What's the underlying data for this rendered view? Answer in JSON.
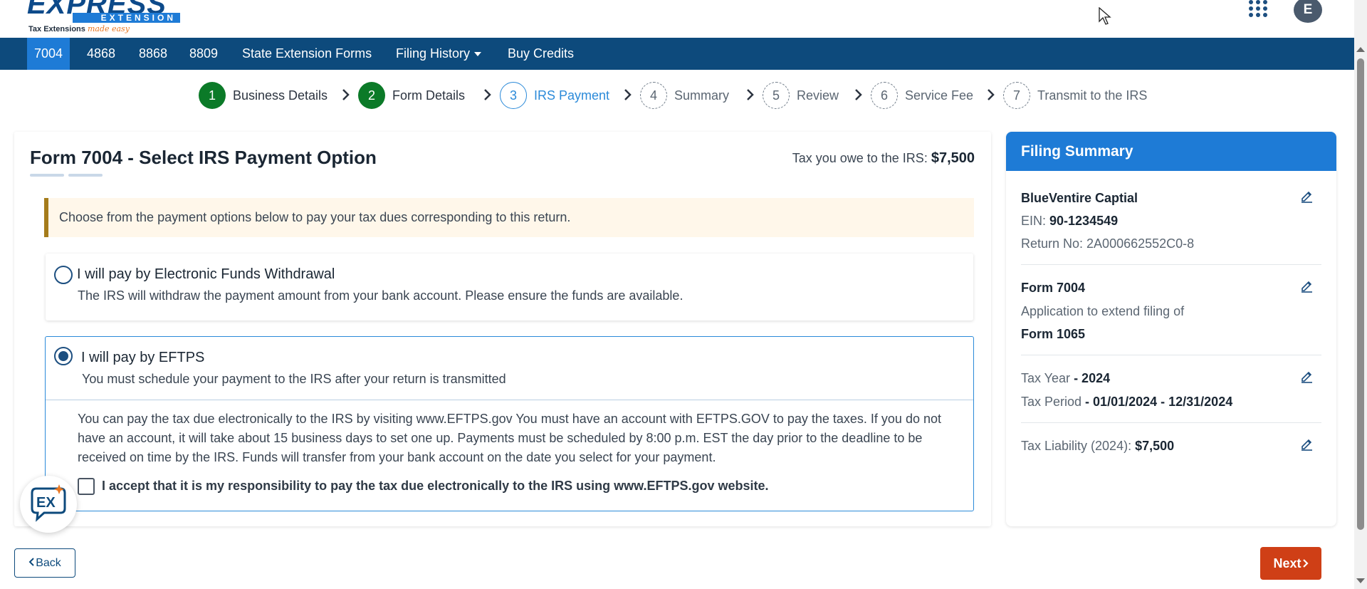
{
  "header": {
    "logo_main": "EXPRESS",
    "logo_band": "EXTENSION",
    "logo_tagline": "Tax Extensions",
    "logo_tagline_script": "made easy",
    "avatar_initial": "E"
  },
  "nav": {
    "items": [
      {
        "label": "7004",
        "active": true
      },
      {
        "label": "4868"
      },
      {
        "label": "8868"
      },
      {
        "label": "8809"
      },
      {
        "label": "State Extension Forms"
      },
      {
        "label": "Filing History",
        "dropdown": true
      },
      {
        "label": "Buy Credits"
      }
    ]
  },
  "stepper": {
    "steps": [
      {
        "number": "1",
        "label": "Business Details",
        "state": "done"
      },
      {
        "number": "2",
        "label": "Form Details",
        "state": "done"
      },
      {
        "number": "3",
        "label": "IRS Payment",
        "state": "current"
      },
      {
        "number": "4",
        "label": "Summary",
        "state": "todo"
      },
      {
        "number": "5",
        "label": "Review",
        "state": "todo"
      },
      {
        "number": "6",
        "label": "Service Fee",
        "state": "todo"
      },
      {
        "number": "7",
        "label": "Transmit to the IRS",
        "state": "todo"
      }
    ]
  },
  "main": {
    "title": "Form 7004 - Select IRS Payment Option",
    "tax_owe_label": "Tax you owe to the IRS: ",
    "tax_owe_value": "$7,500",
    "notice": "Choose from the payment options below to pay your tax dues corresponding to this return.",
    "option_efw": {
      "title": "I will pay by Electronic Funds Withdrawal",
      "description": "The IRS will withdraw the payment amount from your bank account. Please ensure the funds are available.",
      "selected": false
    },
    "option_eftps": {
      "title": "I will pay by EFTPS",
      "description": "You must schedule your payment to the IRS after your return is transmitted",
      "selected": true,
      "details": "You can pay the tax due electronically to the IRS by visiting www.EFTPS.gov You must have an account with EFTPS.GOV to pay the taxes. If you do not have an account, it will take about 15 business days to set one up. Payments must be scheduled by 8:00 p.m. EST the day prior to the deadline to be received on time by the IRS. Funds will transfer from your bank account on the date you select for your payment.",
      "accept_label": "I accept that it is my responsibility to pay the tax due electronically to the IRS using www.EFTPS.gov website.",
      "accept_checked": false
    }
  },
  "summary": {
    "heading": "Filing Summary",
    "business_name": "BlueVentire Captial",
    "ein_label": "EIN: ",
    "ein_value": "90-1234549",
    "return_no": "Return No: 2A000662552C0-8",
    "form_name": "Form 7004",
    "form_desc": "Application to extend filing of",
    "form_target": "Form 1065",
    "tax_year_label": "Tax Year ",
    "tax_year_value": "- 2024",
    "tax_period_label": "Tax Period ",
    "tax_period_value": "- 01/01/2024 - 12/31/2024",
    "liability_label": "Tax Liability (2024): ",
    "liability_value": "$7,500"
  },
  "footer": {
    "back_label": "Back",
    "next_label": "Next"
  },
  "colors": {
    "nav_bg": "#0d4a7c",
    "accent": "#1e7bd6",
    "done_step": "#0b7a28",
    "next_button": "#cf3f16"
  }
}
